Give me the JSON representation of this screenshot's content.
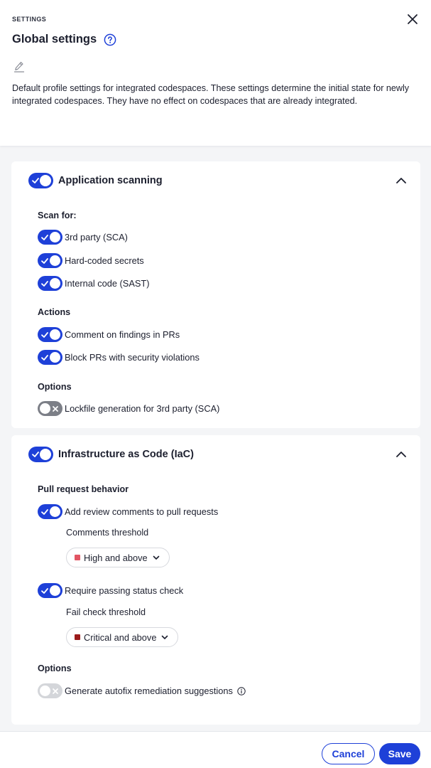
{
  "header": {
    "eyebrow": "SETTINGS",
    "title": "Global settings",
    "description": "Default profile settings for integrated codespaces. These settings determine the initial state for newly integrated codespaces. They have no effect on codespaces that are already integrated."
  },
  "icons": {
    "close": "close-icon",
    "help": "help-icon",
    "edit": "pencil-icon",
    "collapse": "chevron-up-icon",
    "dropdown": "chevron-down-icon",
    "info": "info-icon"
  },
  "colors": {
    "accent": "#1e40d8",
    "toggle_off": "#7c7f87",
    "toggle_disabled": "#d4d6da",
    "severity_high": "#e25563",
    "severity_critical": "#9b1b1b"
  },
  "app_scanning": {
    "title": "Application scanning",
    "enabled": true,
    "scan_for_label": "Scan for:",
    "scan_for": [
      {
        "label": "3rd party (SCA)",
        "state": "on"
      },
      {
        "label": "Hard-coded secrets",
        "state": "on"
      },
      {
        "label": "Internal code (SAST)",
        "state": "on"
      }
    ],
    "actions_label": "Actions",
    "actions": [
      {
        "label": "Comment on findings in PRs",
        "state": "on"
      },
      {
        "label": "Block PRs with security violations",
        "state": "on"
      }
    ],
    "options_label": "Options",
    "options": [
      {
        "label": "Lockfile generation for 3rd party (SCA)",
        "state": "off"
      }
    ]
  },
  "iac": {
    "title": "Infrastructure as Code (IaC)",
    "enabled": true,
    "pr_behavior_label": "Pull request behavior",
    "review_comments": {
      "label": "Add review comments to pull requests",
      "state": "on",
      "threshold_label": "Comments threshold",
      "threshold_value": "High and above"
    },
    "status_check": {
      "label": "Require passing status check",
      "state": "on",
      "threshold_label": "Fail check threshold",
      "threshold_value": "Critical and above"
    },
    "options_label": "Options",
    "autofix": {
      "label": "Generate autofix remediation suggestions",
      "state": "disabled"
    }
  },
  "footer": {
    "cancel_label": "Cancel",
    "save_label": "Save"
  }
}
